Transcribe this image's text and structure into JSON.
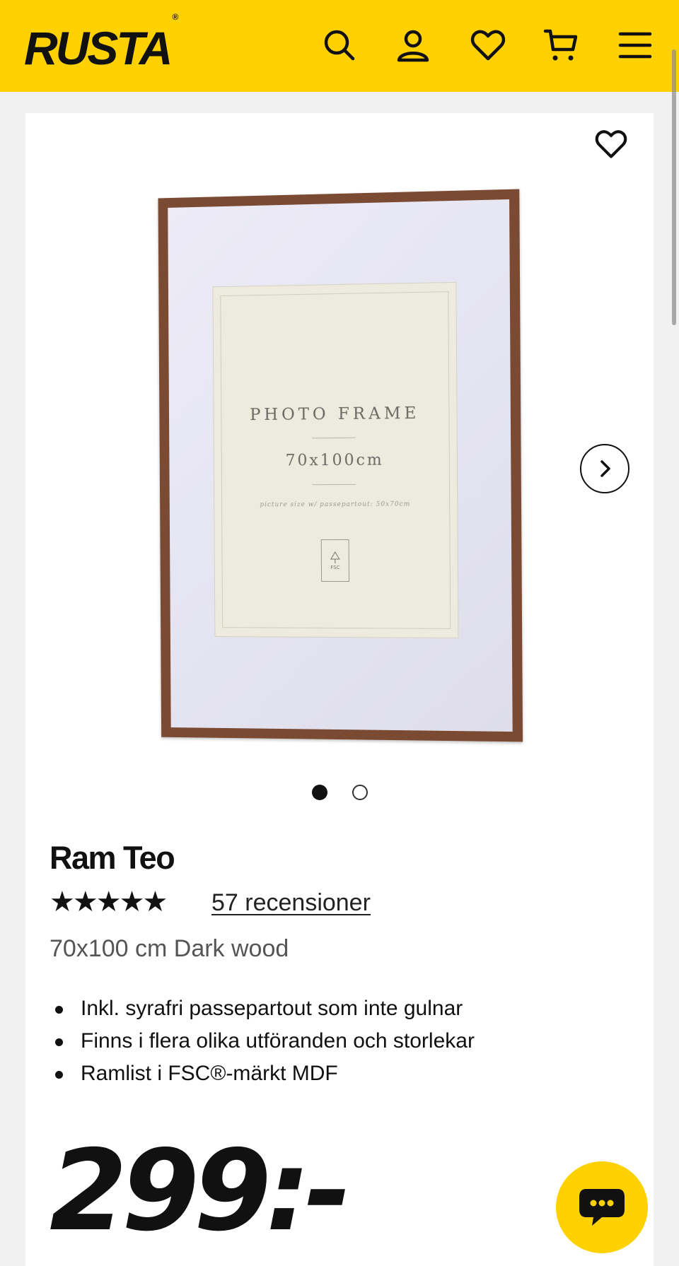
{
  "header": {
    "logo_text": "RUSTA",
    "logo_mark": "®",
    "icons": [
      "search-icon",
      "user-icon",
      "heart-icon",
      "cart-icon",
      "menu-icon"
    ],
    "brand_color": "#ffd100"
  },
  "product": {
    "carousel": {
      "image_text": {
        "title": "PHOTO FRAME",
        "size": "70x100cm",
        "small": "picture size w/ passepartout: 50x70cm",
        "fsc_label": "FSC"
      },
      "slide_count": 2,
      "active_slide": 1
    },
    "title": "Ram Teo",
    "rating": 5,
    "stars": "★★★★★",
    "reviews_label": "57 recensioner",
    "variant": "70x100 cm Dark wood",
    "features": [
      "Inkl. syrafri passepartout som inte gulnar",
      "Finns i flera olika utföranden och storlekar",
      "Ramlist i FSC®-märkt MDF"
    ],
    "price": "299:-"
  },
  "chat": {
    "icon": "chat-icon",
    "color": "#ffd100"
  }
}
